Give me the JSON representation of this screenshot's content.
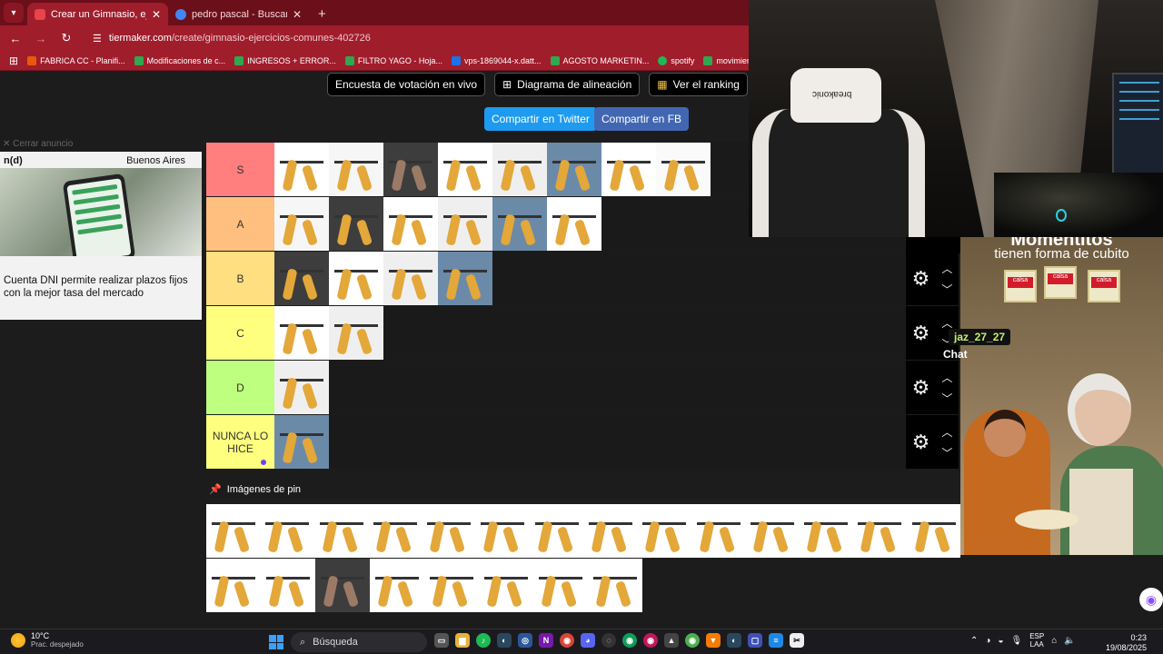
{
  "browser": {
    "tabs": [
      {
        "title": "Crear un Gimnasio, ejercicios c",
        "active": true,
        "favicon_color": "#e9434d"
      },
      {
        "title": "pedro pascal - Buscar con Goo",
        "active": false,
        "favicon_color": "#4285f4"
      }
    ],
    "url_domain": "tiermaker.com",
    "url_path": "/create/gimnasio-ejercicios-comunes-402726",
    "bookmarks": [
      {
        "label": "FABRICA CC - Planifi...",
        "icon": "office-icon"
      },
      {
        "label": "Modificaciones de c...",
        "icon": "sheets-icon"
      },
      {
        "label": "INGRESOS + ERROR...",
        "icon": "sheets-icon"
      },
      {
        "label": "FILTRO YAGO - Hoja...",
        "icon": "sheets-icon"
      },
      {
        "label": "vps-1869044-x.datt...",
        "icon": "site-icon"
      },
      {
        "label": "AGOSTO MARKETIN...",
        "icon": "sheets-icon"
      },
      {
        "label": "spotify",
        "icon": "spotify-icon"
      },
      {
        "label": "movimientos tallere...",
        "icon": "sheets-icon"
      }
    ]
  },
  "page": {
    "buttons": {
      "live_vote": "Encuesta de votación en vivo",
      "alignment": "Diagrama de alineación",
      "ranking": "Ver el ranking"
    },
    "share": {
      "twitter": "Compartir en Twitter",
      "facebook": "Compartir en FB"
    },
    "ad": {
      "close": "Cerrar anuncio",
      "brand": "n(d)",
      "city": "Buenos Aires",
      "copy": "Cuenta DNI permite realizar plazos fijos con la mejor tasa del mercado"
    },
    "tiers": [
      {
        "label": "S",
        "color": "#ff7f7f",
        "items": 8
      },
      {
        "label": "A",
        "color": "#ffbf7f",
        "items": 6
      },
      {
        "label": "B",
        "color": "#ffdf7f",
        "items": 4
      },
      {
        "label": "C",
        "color": "#ffff7f",
        "items": 2
      },
      {
        "label": "D",
        "color": "#bfff7f",
        "items": 1
      },
      {
        "label": "NUNCA LO HICE",
        "color": "#ffff7f",
        "items": 1
      }
    ],
    "pool_title": "Imágenes de pin",
    "pool_rows": [
      14,
      8
    ]
  },
  "overlay": {
    "side_ad_title": "Momentitos",
    "side_ad_subtitle": "tienen forma de cubito",
    "brand_pkg": "calsa",
    "chat_user": "jaz_27_27",
    "chat_label": "Chat",
    "chair_logo": "breakonic"
  },
  "taskbar": {
    "temp": "10°C",
    "weather": "Prac. despejado",
    "search": "Búsqueda",
    "lang_top": "ESP",
    "lang_bottom": "LAA",
    "time": "0:23",
    "date": "19/08/2025"
  }
}
